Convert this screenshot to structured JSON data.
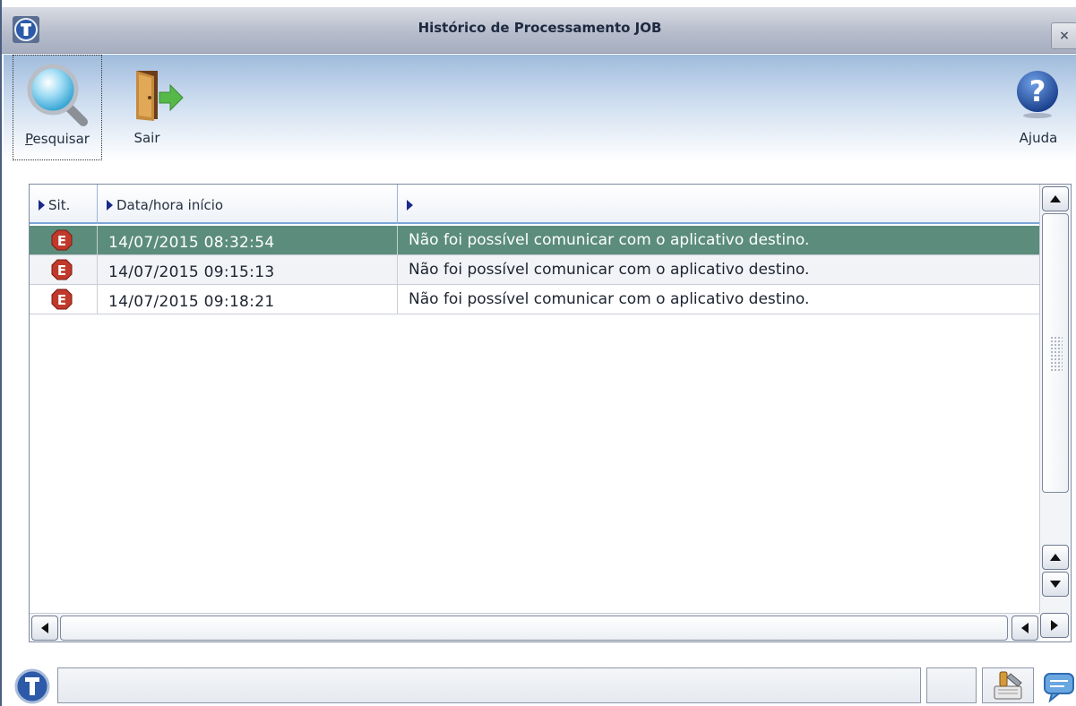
{
  "window": {
    "title": "Histórico de Processamento JOB",
    "close_label": "×"
  },
  "toolbar": {
    "search_label": "Pesquisar",
    "exit_label": "Sair",
    "help_label": "Ajuda"
  },
  "grid": {
    "columns": [
      "Sit.",
      "Data/hora início",
      ""
    ],
    "rows": [
      {
        "status": "error",
        "status_glyph": "E",
        "datetime": "14/07/2015 08:32:54",
        "message": "Não foi possível comunicar com o aplicativo destino.",
        "selected": true
      },
      {
        "status": "error",
        "status_glyph": "E",
        "datetime": "14/07/2015 09:15:13",
        "message": "Não foi possível comunicar com o aplicativo destino.",
        "selected": false
      },
      {
        "status": "error",
        "status_glyph": "E",
        "datetime": "14/07/2015 09:18:21",
        "message": "Não foi possível comunicar com o aplicativo destino.",
        "selected": false
      }
    ]
  },
  "statusbar": {
    "message": ""
  },
  "colors": {
    "selected_row": "#5b8c7c",
    "error_icon": "#c0392b",
    "toolbar_top": "#9fbbdc",
    "title_text": "#1d2a40"
  },
  "icons": {
    "app_logo": "app-logo-icon",
    "search": "magnifier-icon",
    "exit": "door-exit-icon",
    "help": "help-question-icon",
    "error": "error-e-icon",
    "tool": "tools-icon",
    "chat": "chat-bubble-icon"
  }
}
